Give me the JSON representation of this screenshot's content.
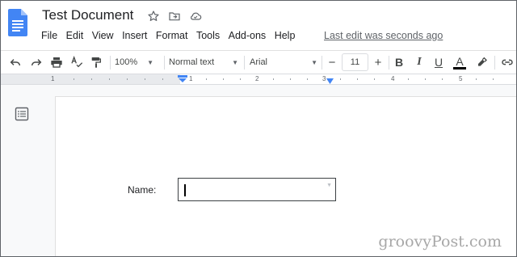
{
  "header": {
    "title": "Test Document",
    "last_edit": "Last edit was seconds ago",
    "icons": [
      "star-icon",
      "move-to-folder-icon",
      "cloud-status-icon"
    ]
  },
  "menu": [
    "File",
    "Edit",
    "View",
    "Insert",
    "Format",
    "Tools",
    "Add-ons",
    "Help"
  ],
  "toolbar": {
    "zoom": "100%",
    "style": "Normal text",
    "font": "Arial",
    "font_size": "11",
    "decrease": "−",
    "increase": "+",
    "bold": "B",
    "italic": "I",
    "underline": "U",
    "text_color": "A"
  },
  "ruler": {
    "numbers": [
      "1",
      "1",
      "2",
      "3",
      "4",
      "5"
    ]
  },
  "document": {
    "name_label": "Name:",
    "textbox_value": ""
  },
  "watermark": "groovyPost.com",
  "colors": {
    "docs_blue": "#4285f4",
    "toolbar_icon": "#444746"
  }
}
